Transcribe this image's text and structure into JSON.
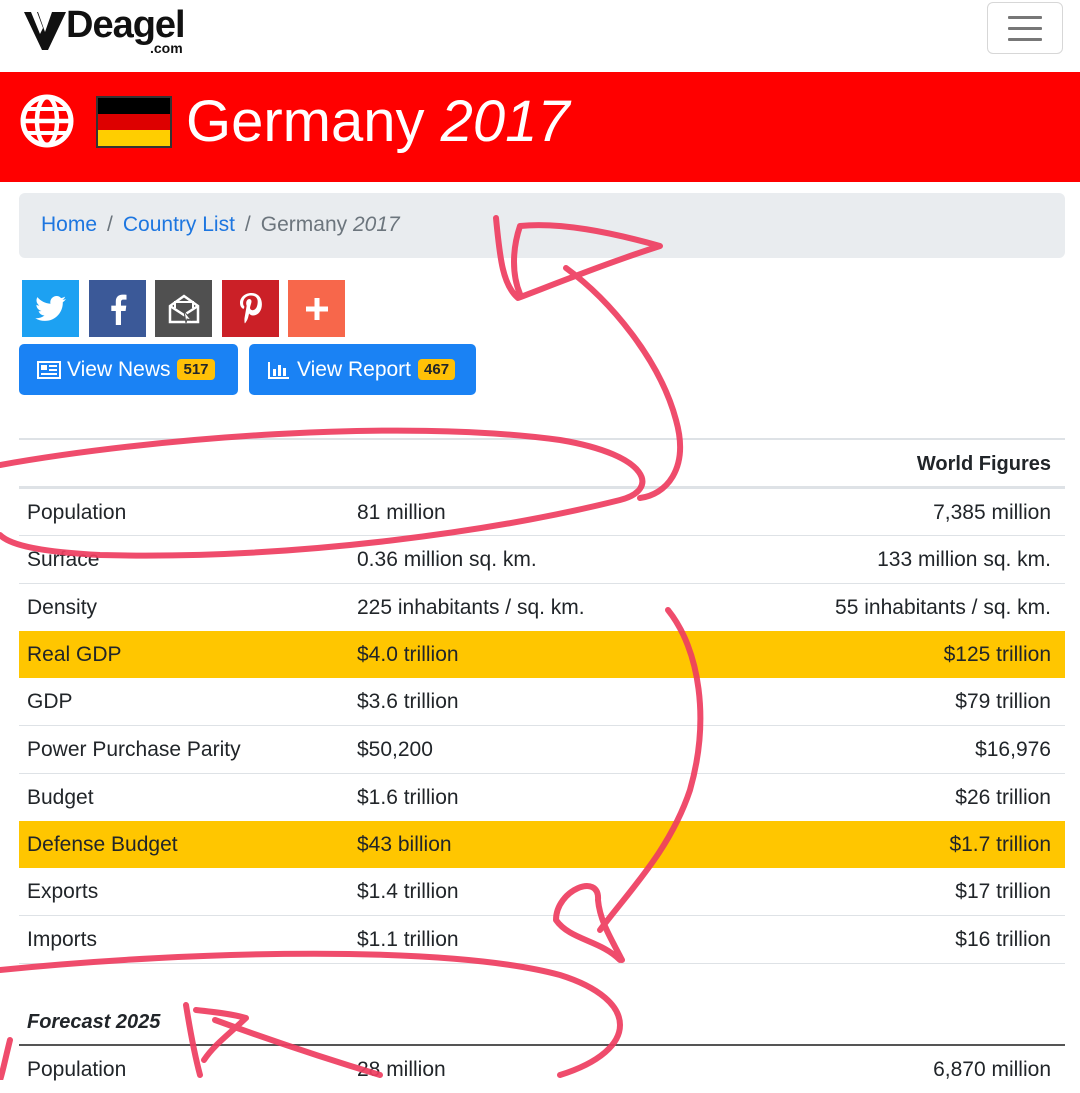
{
  "header": {
    "logo_text": "Deagel",
    "logo_suffix": ".com",
    "menu_icon": "hamburger-icon"
  },
  "banner": {
    "country": "Germany",
    "year": "2017",
    "flag_colors": [
      "#000000",
      "#dd0000",
      "#ffce00"
    ],
    "globe_icon": "globe-icon"
  },
  "breadcrumb": {
    "home": "Home",
    "country_list": "Country List",
    "current": "Germany",
    "current_year": "2017"
  },
  "share": [
    {
      "name": "twitter",
      "icon": "twitter-icon",
      "color": "#1da1f2"
    },
    {
      "name": "facebook",
      "icon": "facebook-icon",
      "color": "#3b5998"
    },
    {
      "name": "email",
      "icon": "envelope-icon",
      "color": "#505050"
    },
    {
      "name": "pinterest",
      "icon": "pinterest-icon",
      "color": "#cb2027"
    },
    {
      "name": "more",
      "icon": "plus-icon",
      "color": "#f7674b"
    }
  ],
  "buttons": {
    "news_label": "View News",
    "news_count": "517",
    "report_label": "View Report",
    "report_count": "467"
  },
  "table": {
    "world_header": "World Figures",
    "rows": [
      {
        "label": "Population",
        "value": "81 million",
        "world": "7,385 million"
      },
      {
        "label": "Surface",
        "value": "0.36 million sq. km.",
        "world": "133 million sq. km."
      },
      {
        "label": "Density",
        "value": "225 inhabitants / sq. km.",
        "world": "55 inhabitants / sq. km."
      },
      {
        "label": "Real GDP",
        "value": "$4.0 trillion",
        "world": "$125 trillion",
        "highlight": true
      },
      {
        "label": "GDP",
        "value": "$3.6 trillion",
        "world": "$79 trillion"
      },
      {
        "label": "Power Purchase Parity",
        "value": "$50,200",
        "world": "$16,976"
      },
      {
        "label": "Budget",
        "value": "$1.6 trillion",
        "world": "$26 trillion"
      },
      {
        "label": "Defense Budget",
        "value": "$43 billion",
        "world": "$1.7 trillion",
        "highlight": true
      },
      {
        "label": "Exports",
        "value": "$1.4 trillion",
        "world": "$17 trillion"
      },
      {
        "label": "Imports",
        "value": "$1.1 trillion",
        "world": "$16 trillion"
      }
    ]
  },
  "forecast": {
    "title": "Forecast 2025",
    "rows": [
      {
        "label": "Population",
        "value": "28 million",
        "world": "6,870 million"
      }
    ]
  },
  "colors": {
    "banner_red": "#ff0000",
    "button_blue": "#1a82f4",
    "highlight_yellow": "#ffc600",
    "annotation_pink": "#ee3d60"
  }
}
